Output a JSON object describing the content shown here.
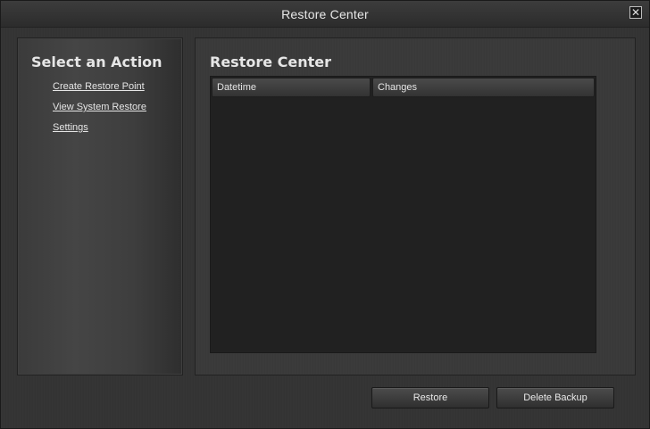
{
  "window": {
    "title": "Restore Center",
    "close_glyph": "✕"
  },
  "sidebar": {
    "heading": "Select an Action",
    "links": [
      {
        "label": "Create Restore Point"
      },
      {
        "label": "View System Restore"
      },
      {
        "label": "Settings"
      }
    ]
  },
  "main": {
    "heading": "Restore Center",
    "table": {
      "columns": [
        "Datetime",
        "Changes"
      ],
      "rows": []
    }
  },
  "footer": {
    "restore_label": "Restore",
    "delete_label": "Delete Backup"
  }
}
